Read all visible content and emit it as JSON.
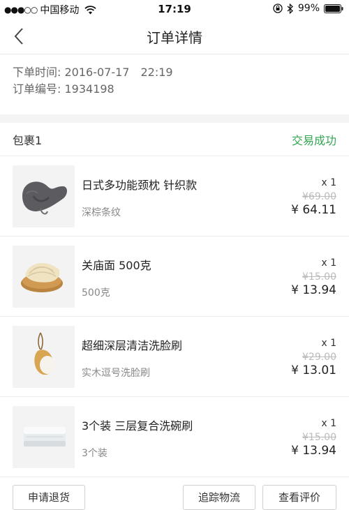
{
  "status_bar": {
    "signal": "●●●○○",
    "carrier": "中国移动",
    "time": "17:19",
    "battery_percent": "99%"
  },
  "nav": {
    "title": "订单详情"
  },
  "order_info": {
    "order_time": "下单时间: 2016-07-17　22:19",
    "order_number": "订单编号: 1934198"
  },
  "package": {
    "label": "包裹1",
    "status": "交易成功",
    "status_color": "#33a652"
  },
  "items": [
    {
      "name": "日式多功能颈枕 针织款",
      "variant": "深棕条纹",
      "qty": "x 1",
      "original_price": "¥69.00",
      "price": "¥ 64.11",
      "image": "neck-pillow-image"
    },
    {
      "name": "关庙面 500克",
      "variant": "500克",
      "qty": "x 1",
      "original_price": "¥15.00",
      "price": "¥ 13.94",
      "image": "noodles-image"
    },
    {
      "name": "超细深层清洁洗脸刷",
      "variant": "实木逗号洗脸刷",
      "qty": "x 1",
      "original_price": "¥29.00",
      "price": "¥ 13.01",
      "image": "face-brush-image"
    },
    {
      "name": "3个装 三层复合洗碗刷",
      "variant": "3个装",
      "qty": "x 1",
      "original_price": "¥15.00",
      "price": "¥ 13.94",
      "image": "dish-sponge-image"
    }
  ],
  "actions": {
    "return_label": "申请退货",
    "track_label": "追踪物流",
    "review_label": "查看评价"
  }
}
